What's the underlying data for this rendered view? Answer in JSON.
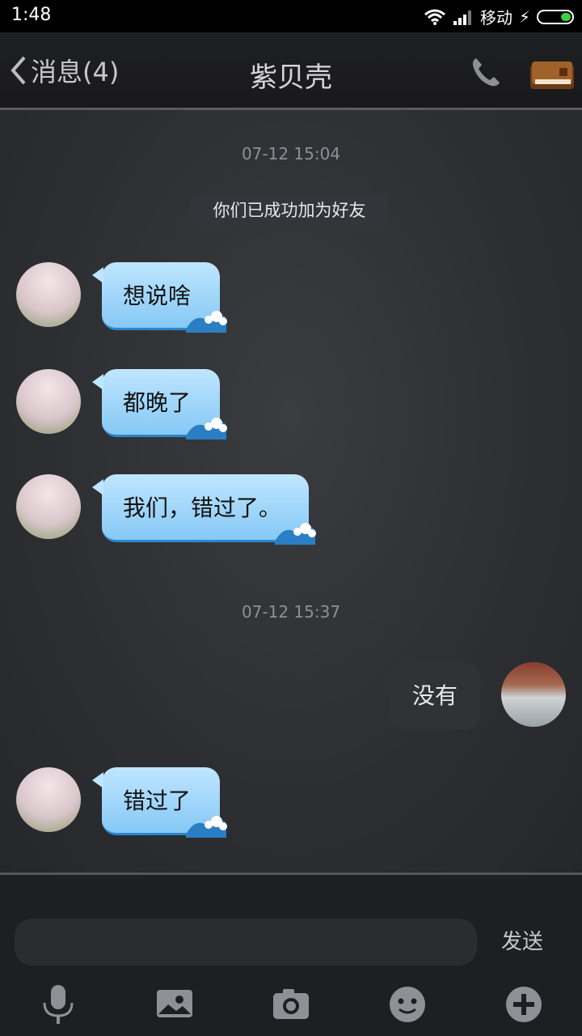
{
  "status_bar": {
    "time": "1:48",
    "carrier": "移动"
  },
  "header": {
    "back_label": "消息(4)",
    "title": "紫贝壳"
  },
  "chat": {
    "time_divider_1": "07-12 15:04",
    "system_message": "你们已成功加为好友",
    "messages": [
      {
        "text": "想说啥"
      },
      {
        "text": "都晚了"
      },
      {
        "text": "我们，错过了。"
      }
    ],
    "time_divider_2": "07-12 15:37",
    "outgoing": {
      "text": "没有"
    },
    "last_message": {
      "text": "错过了"
    }
  },
  "input": {
    "placeholder": "",
    "send_label": "发送"
  },
  "colors": {
    "bubble_in": "#9fd6fb",
    "bubble_out": "#303236",
    "background": "#2a2c30"
  },
  "icons": [
    "back-icon",
    "phone-icon",
    "book-icon",
    "microphone-icon",
    "image-icon",
    "camera-icon",
    "emoji-icon",
    "plus-icon"
  ]
}
